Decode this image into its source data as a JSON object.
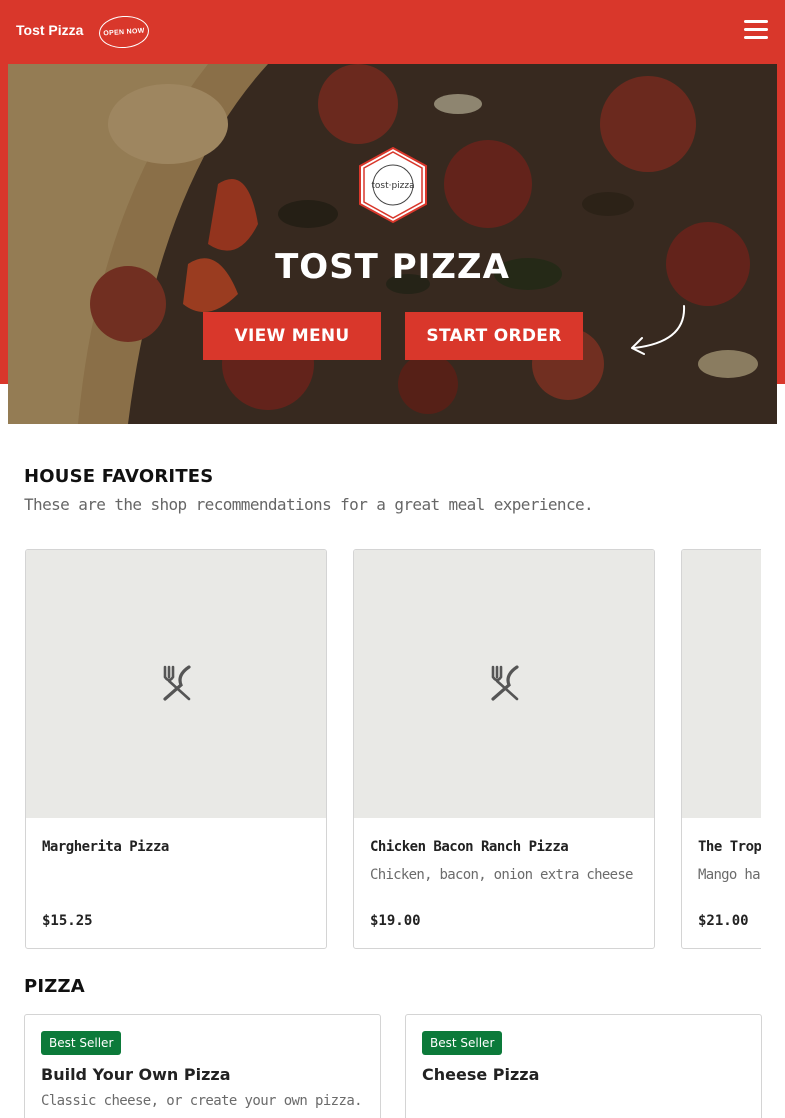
{
  "header": {
    "brand": "Tost Pizza",
    "open_badge": "OPEN NOW",
    "menu_icon": "hamburger-menu-icon"
  },
  "hero": {
    "logo_text": "tost·pizza",
    "title": "TOST PIZZA",
    "view_menu_label": "VIEW MENU",
    "start_order_label": "START ORDER"
  },
  "house_favorites": {
    "title": "HOUSE FAVORITES",
    "subtitle": "These are the shop recommendations for a great meal experience.",
    "items": [
      {
        "name": "Margherita Pizza",
        "description": "",
        "price": "$15.25"
      },
      {
        "name": "Chicken Bacon Ranch Pizza",
        "description": "Chicken, bacon, onion extra cheese",
        "price": "$19.00"
      },
      {
        "name": "The Tropic",
        "description": "Mango ha onion, pep",
        "price": "$21.00"
      }
    ]
  },
  "pizza": {
    "title": "PIZZA",
    "items": [
      {
        "badge": "Best Seller",
        "name": "Build Your Own Pizza",
        "description": "Classic cheese, or create your own pizza."
      },
      {
        "badge": "Best Seller",
        "name": "Cheese Pizza",
        "description": ""
      }
    ]
  },
  "colors": {
    "brand_red": "#d9372b",
    "badge_green": "#0c7a3a",
    "placeholder_gray": "#e9e9e6"
  }
}
